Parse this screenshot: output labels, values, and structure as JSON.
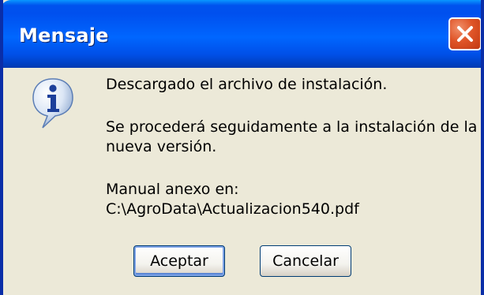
{
  "window": {
    "title": "Mensaje",
    "close_icon": "close-icon"
  },
  "message": {
    "icon": "info-icon",
    "line1": "Descargado el archivo de instalación.",
    "line2": "Se procederá seguidamente a la instalación de la",
    "line3": "nueva versión.",
    "line4": "Manual anexo en:",
    "line5": "C:\\AgroData\\Actualizacion540.pdf"
  },
  "buttons": {
    "accept_label": "Aceptar",
    "cancel_label": "Cancelar"
  },
  "colors": {
    "titlebar": "#0054e3",
    "close_button": "#e05528",
    "dialog_background": "#ece9d8"
  }
}
